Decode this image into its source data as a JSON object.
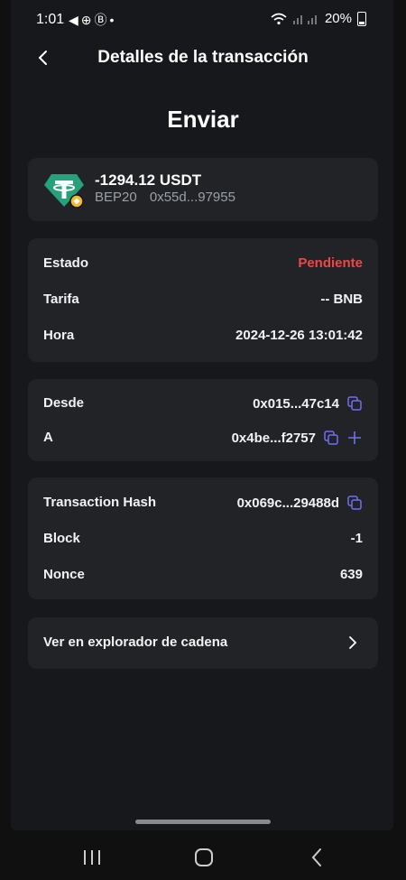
{
  "status_bar": {
    "time": "1:01",
    "battery": "20%",
    "left_icons": [
      "telegram-icon",
      "add-circle-icon",
      "b-circle-icon",
      "dot-icon"
    ]
  },
  "header": {
    "title": "Detalles de la transacción"
  },
  "page_heading": "Enviar",
  "token": {
    "amount": "-1294.12 USDT",
    "network": "BEP20",
    "address": "0x55d...97955",
    "icon": "tether-icon"
  },
  "details": {
    "estado_label": "Estado",
    "estado_value": "Pendiente",
    "tarifa_label": "Tarifa",
    "tarifa_value": "-- BNB",
    "hora_label": "Hora",
    "hora_value": "2024-12-26 13:01:42"
  },
  "addresses": {
    "desde_label": "Desde",
    "desde_value": "0x015...47c14",
    "a_label": "A",
    "a_value": "0x4be...f2757"
  },
  "chain": {
    "hash_label": "Transaction Hash",
    "hash_value": "0x069c...29488d",
    "block_label": "Block",
    "block_value": "-1",
    "nonce_label": "Nonce",
    "nonce_value": "639"
  },
  "explorer": {
    "label": "Ver en explorador de cadena"
  },
  "colors": {
    "accent": "#6f6ff0",
    "pending": "#f04646",
    "tether": "#26a17b",
    "bnb": "#f3ba2f"
  }
}
